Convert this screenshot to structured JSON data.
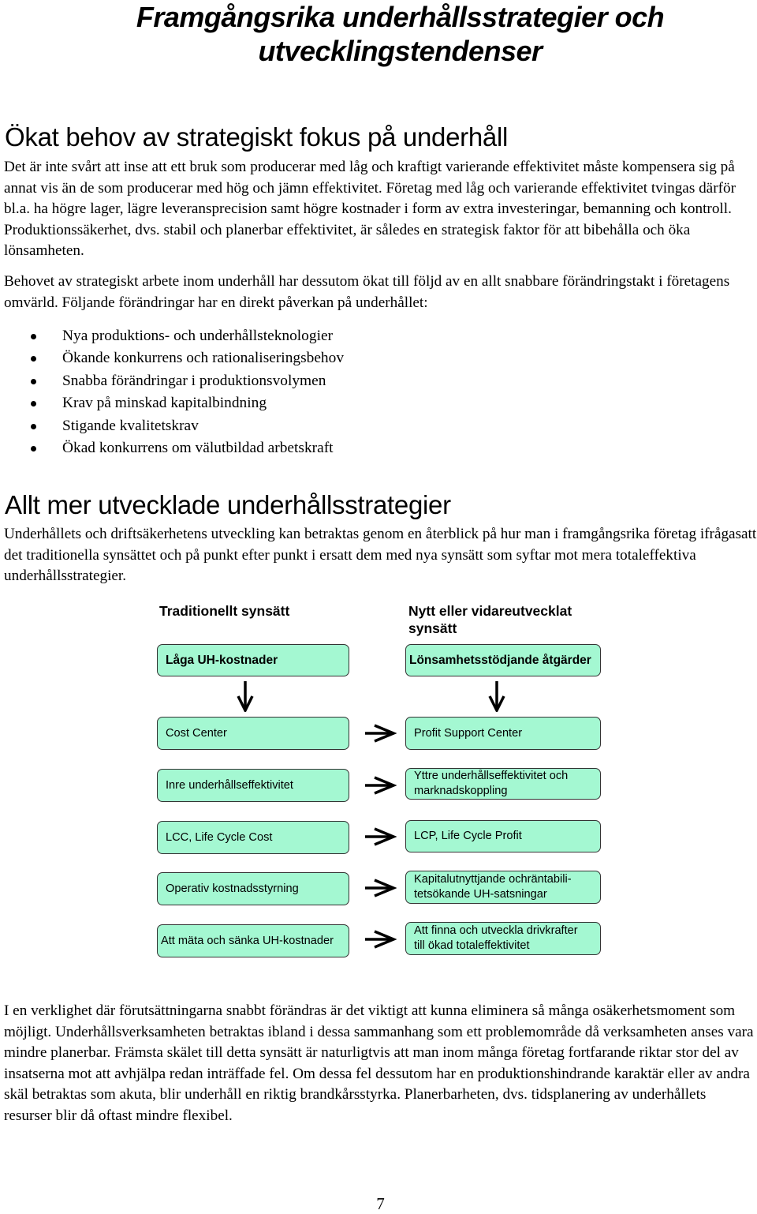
{
  "document": {
    "title_lines": [
      "Framgångsrika underhållsstrategier och",
      "utvecklingstendenser"
    ],
    "sections": [
      {
        "heading": "Ökat behov av strategiskt fokus på underhåll",
        "paragraphs": [
          "Det är inte svårt att inse att ett bruk som producerar med låg och kraftigt varierande effektivitet måste kompensera sig på annat vis än de som producerar med hög och jämn effektivitet. Företag med låg och varierande effektivitet tvingas därför bl.a. ha högre lager, lägre leveransprecision samt högre kostnader i form av extra investeringar, bemanning och kontroll. Produktionssäkerhet, dvs. stabil och planerbar effektivitet, är således en strategisk faktor för att bibehålla och öka lönsamheten.",
          "Behovet av strategiskt arbete inom underhåll har dessutom ökat till följd av en allt snabbare förändringstakt i företagens omvärld. Följande förändringar har en direkt påverkan på underhållet:"
        ],
        "bullets": [
          "Nya produktions- och underhållsteknologier",
          "Ökande konkurrens och rationaliseringsbehov",
          "Snabba förändringar i produktionsvolymen",
          "Krav på minskad kapitalbindning",
          "Stigande kvalitetskrav",
          "Ökad konkurrens om välutbildad arbetskraft"
        ]
      },
      {
        "heading": "Allt mer utvecklade underhållsstrategier",
        "paragraphs": [
          "Underhållets och driftsäkerhetens utveckling kan betraktas genom en återblick på hur man i framgångsrika företag ifrågasatt det traditionella synsättet och på punkt efter punkt i ersatt dem med nya synsätt som syftar mot mera totaleffektiva underhållsstrategier.",
          "I en verklighet där förutsättningarna snabbt förändras är det viktigt att kunna eliminera så många osäkerhetsmoment som möjligt. Underhållsverksamheten betraktas ibland i dessa sammanhang som ett problemområde då verksamheten anses vara mindre planerbar. Främsta skälet till detta synsätt är naturligtvis att man inom många företag fortfarande riktar stor del av insatserna mot att avhjälpa redan inträffade fel. Om dessa fel dessutom har en produktionshindrande karaktär eller av andra skäl betraktas som akuta, blir underhåll en riktig brandkårsstyrka. Planerbarheten, dvs. tidsplanering av underhållets resurser blir då oftast mindre flexibel."
        ]
      }
    ],
    "page_number": "7"
  },
  "diagram": {
    "box_fill": "#a4f8d2",
    "box_border": "#333333",
    "left_header": "Traditionellt synsätt",
    "right_header_lines": [
      "Nytt eller vidareutvecklat",
      "synsätt"
    ],
    "left_top": "Låga UH-kostnader",
    "right_top": "Lönsamhetsstödjande åtgärder",
    "down_arrow_icon": "arrow-down-icon",
    "right_arrow_icon": "arrow-right-icon",
    "rows": [
      {
        "left": [
          "Cost Center"
        ],
        "right": [
          "Profit Support Center"
        ]
      },
      {
        "left": [
          "Inre underhållseffektivitet"
        ],
        "right": [
          "Yttre underhållseffektivitet och",
          "marknadskoppling"
        ]
      },
      {
        "left": [
          "LCC, Life Cycle Cost"
        ],
        "right": [
          "LCP, Life Cycle Profit"
        ]
      },
      {
        "left": [
          "Operativ kostnadsstyrning"
        ],
        "right": [
          "Kapitalutnyttjande ochräntabili-",
          "tetsökande UH-satsningar"
        ]
      },
      {
        "left": [
          "Att mäta och sänka UH-kostnader"
        ],
        "right": [
          "Att finna och utveckla drivkrafter",
          "till ökad totaleffektivitet"
        ]
      }
    ]
  }
}
